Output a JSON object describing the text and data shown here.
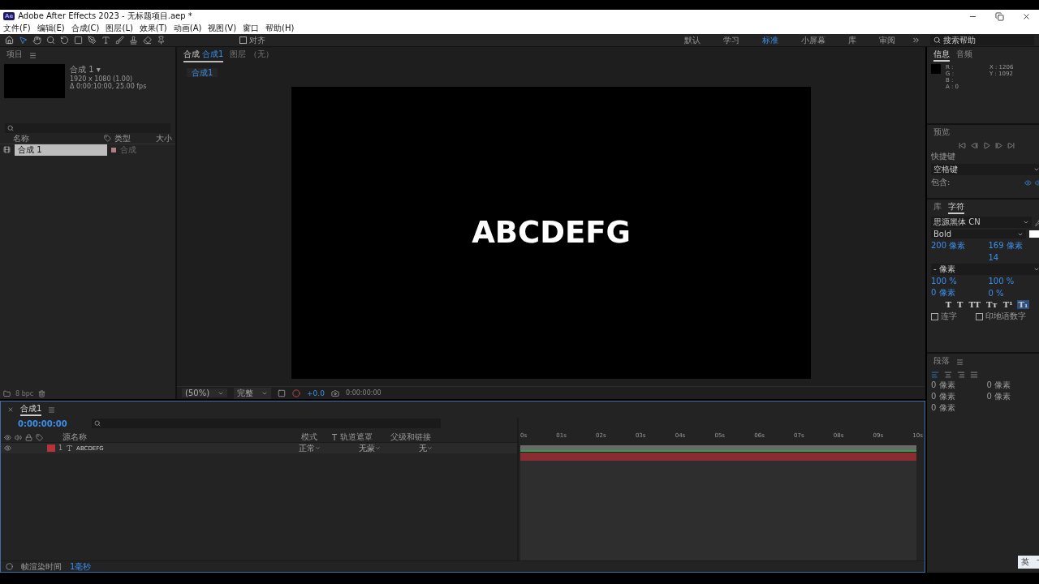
{
  "window": {
    "app_badge": "Ae",
    "title": "Adobe After Effects 2023 - 无标题项目.aep *"
  },
  "menu": [
    "文件(F)",
    "编辑(E)",
    "合成(C)",
    "图层(L)",
    "效果(T)",
    "动画(A)",
    "视图(V)",
    "窗口",
    "帮助(H)"
  ],
  "toolbar": {
    "snap_label": "对齐",
    "snap_checked": false
  },
  "workspaces": [
    {
      "label": "默认",
      "selected": false
    },
    {
      "label": "学习",
      "selected": false
    },
    {
      "label": "标准",
      "selected": true
    },
    {
      "label": "小屏幕",
      "selected": false
    },
    {
      "label": "库",
      "selected": false
    },
    {
      "label": "审阅",
      "selected": false
    }
  ],
  "help_search": {
    "placeholder": "搜索帮助"
  },
  "project": {
    "title": "项目",
    "comp_name": "合成 1 ▾",
    "comp_size": "1920 x 1080 (1.00)",
    "comp_duration": "Δ 0:00:10:00, 25.00 fps",
    "columns": [
      "名称",
      "类型",
      "大小"
    ],
    "items": [
      {
        "name": "合成 1",
        "type": "合成",
        "selected": true
      }
    ],
    "bpc": "8 bpc"
  },
  "viewer": {
    "tabs": [
      {
        "label": "合成",
        "comp": "合成1",
        "selected": true
      },
      {
        "label": "图层 （无）",
        "selected": false
      }
    ],
    "breadcrumb": "合成1",
    "text": "ABCDEFG",
    "zoom": "(50%)",
    "quality": "完整",
    "exposure": "+0.0",
    "timecode": "0:00:00:00"
  },
  "timeline": {
    "tab": "合成1",
    "timecode": "0:00:00:00",
    "columns": [
      "源名称",
      "模式",
      "T",
      "轨道遮罩",
      "父级和链接"
    ],
    "layers": [
      {
        "number": "1",
        "name": "ABCDEFG",
        "mode": "正常",
        "matte": "无蒙",
        "parent": "无",
        "color": "#b8323c"
      }
    ],
    "ruler": [
      "0s",
      "01s",
      "02s",
      "03s",
      "04s",
      "05s",
      "06s",
      "07s",
      "08s",
      "09s",
      "10s"
    ],
    "render_label": "帧渲染时间",
    "render_value": "1毫秒"
  },
  "info": {
    "tabs": [
      {
        "label": "信息",
        "selected": true
      },
      {
        "label": "音频",
        "selected": false
      }
    ],
    "channels": [
      "R :",
      "G :",
      "B :",
      "A : 0"
    ],
    "x": "X : 1206",
    "y": "Y : 1092"
  },
  "preview": {
    "title": "预览",
    "shortcut_label": "快捷键",
    "shortcut": "空格键",
    "include_label": "包含:"
  },
  "character": {
    "tabs": [
      {
        "label": "库",
        "selected": false
      },
      {
        "label": "字符",
        "selected": true
      }
    ],
    "font": "思源黑体 CN",
    "style": "Bold",
    "size": "200 像素",
    "leading": "169 像素",
    "tracking": "14",
    "line": "- 像素",
    "vscale": "100 %",
    "hscale": "100 %",
    "baseline": "0 像素",
    "tsume": "0 %",
    "styles": [
      {
        "label": "T",
        "selected": false
      },
      {
        "label": "T",
        "selected": false
      },
      {
        "label": "TT",
        "selected": false
      },
      {
        "label": "Tт",
        "selected": false
      },
      {
        "label": "T¹",
        "selected": false
      },
      {
        "label": "T₁",
        "selected": true
      }
    ],
    "options": [
      {
        "label": "连字",
        "checked": false
      },
      {
        "label": "印地语数字",
        "checked": false
      }
    ]
  },
  "paragraph": {
    "title": "段落",
    "fields": [
      "0 像素",
      "0 像素",
      "0 像素",
      "0 像素",
      "0 像素"
    ]
  },
  "ime": "英"
}
